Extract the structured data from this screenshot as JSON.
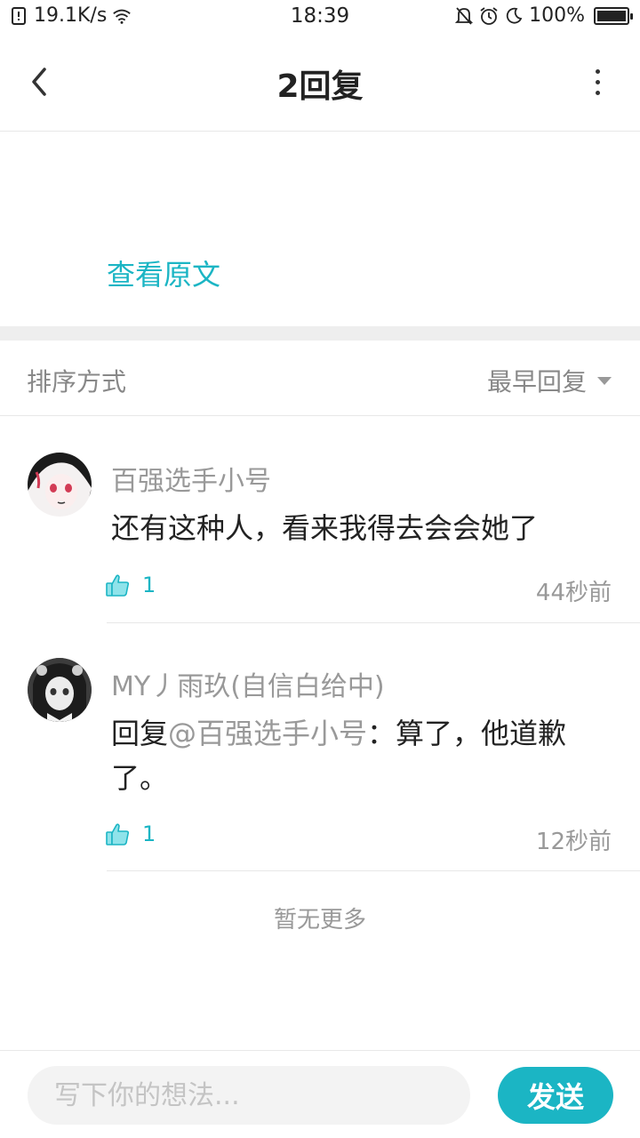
{
  "status_bar": {
    "speed": "19.1K/s",
    "time": "18:39",
    "battery": "100%",
    "battery_level": 1.0
  },
  "nav": {
    "title": "2回复",
    "back_icon": "chevron-left-icon",
    "more_icon": "more-vertical-icon"
  },
  "original": {
    "link_label": "查看原文"
  },
  "sort": {
    "label": "排序方式",
    "selected": "最早回复"
  },
  "comments": [
    {
      "username": "百强选手小号",
      "text": "还有这种人，看来我得去会会她了",
      "likes": "1",
      "time": "44秒前"
    },
    {
      "username": "MY丿雨玖(自信白给中)",
      "reply_prefix": "回复",
      "mention": "@百强选手小号",
      "text": "：算了，他道歉了。",
      "likes": "1",
      "time": "12秒前"
    }
  ],
  "footer": {
    "no_more": "暂无更多"
  },
  "input": {
    "placeholder": "写下你的想法...",
    "send_label": "发送"
  },
  "colors": {
    "accent": "#1bb5c4"
  }
}
